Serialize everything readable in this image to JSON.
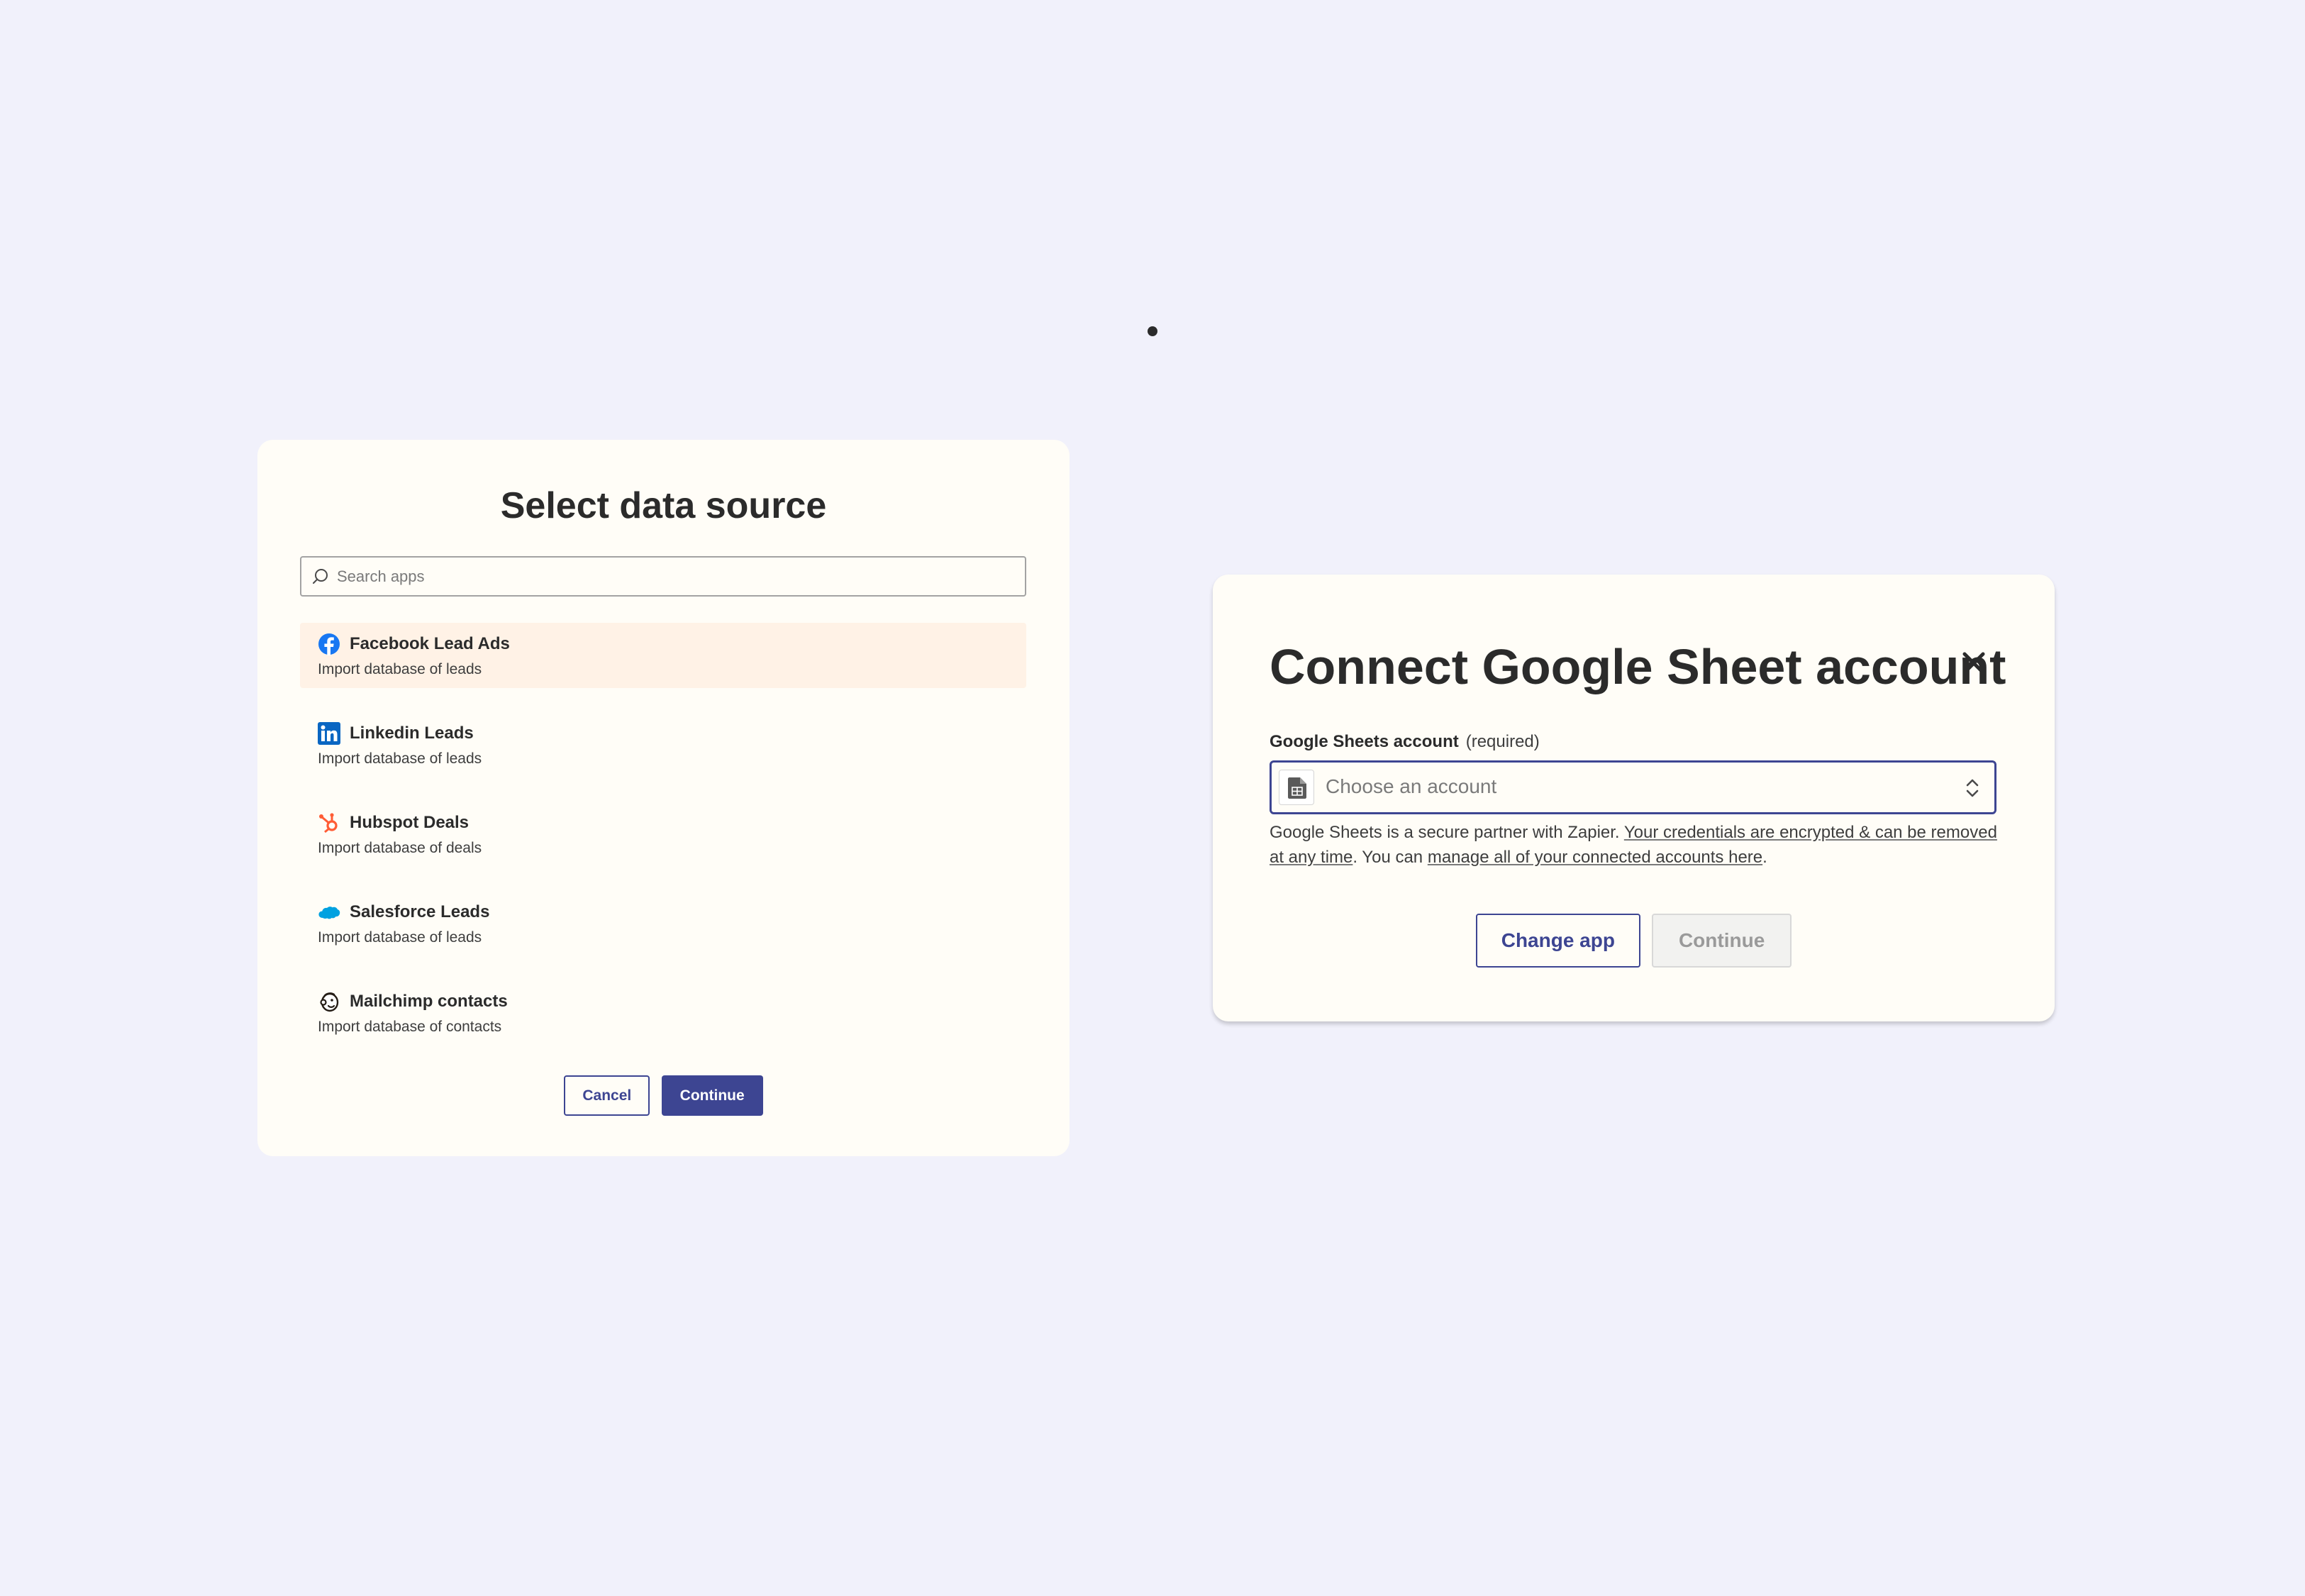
{
  "select_source": {
    "title": "Select data source",
    "search": {
      "placeholder": "Search apps",
      "value": "",
      "icon": "search-icon"
    },
    "items": [
      {
        "name": "Facebook Lead Ads",
        "description": "Import database of leads",
        "icon": "facebook-icon",
        "color": "#1877f2",
        "selected": true
      },
      {
        "name": "Linkedin Leads",
        "description": "Import database of leads",
        "icon": "linkedin-icon",
        "color": "#0a66c2",
        "selected": false
      },
      {
        "name": "Hubspot Deals",
        "description": "Import database of deals",
        "icon": "hubspot-icon",
        "color": "#ff5c35",
        "selected": false
      },
      {
        "name": "Salesforce Leads",
        "description": "Import database of leads",
        "icon": "salesforce-icon",
        "color": "#00a1e0",
        "selected": false
      },
      {
        "name": "Mailchimp contacts",
        "description": "Import database of contacts",
        "icon": "mailchimp-icon",
        "color": "#241c15",
        "selected": false
      }
    ],
    "cancel_label": "Cancel",
    "continue_label": "Continue"
  },
  "connect_account": {
    "title": "Connect Google Sheet account",
    "field_label": "Google Sheets account",
    "field_required": "(required)",
    "select_placeholder": "Choose an account",
    "helper": {
      "text_1": "Google Sheets is a secure partner with Zapier. ",
      "link_1": "Your credentials are encrypted & can be removed at any time",
      "text_2": ". You can ",
      "link_2": "manage all of your connected accounts here",
      "text_3": "."
    },
    "change_app_label": "Change app",
    "continue_label": "Continue",
    "continue_disabled": true
  },
  "colors": {
    "accent": "#3d4592",
    "background": "#f1f1fb",
    "card": "#fffdf7",
    "selected_row": "#fff2e6"
  }
}
